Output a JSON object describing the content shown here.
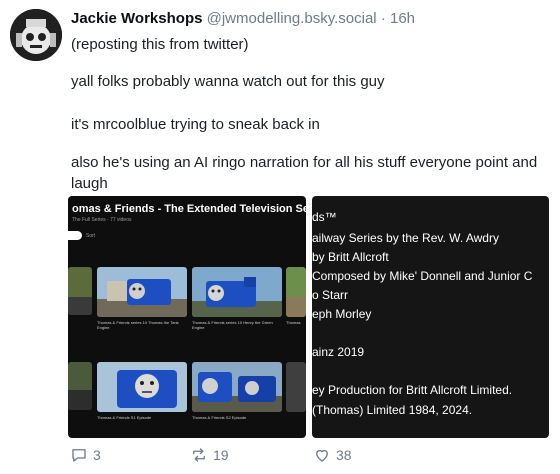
{
  "post": {
    "display_name": "Jackie Workshops",
    "handle": "@jwmodelling.bsky.social",
    "separator": "·",
    "time": "16h",
    "lines": [
      "(reposting this from twitter)",
      "yall folks probably wanna watch out for this guy",
      "it's mrcoolblue trying to sneak back in",
      "also he's using an AI ringo narration for all his stuff everyone point and laugh"
    ]
  },
  "embed_left": {
    "playlist_title": "omas & Friends - The Extended Television Series",
    "playlist_sub": "The Full Series · 77 videos",
    "sort_label": "Sort",
    "thumbs": [
      {
        "caption": "Thomas & Friends series 10 Thomas the Tank Engine",
        "label": "Thomas"
      },
      {
        "caption": "Thomas & Friends series 10 Henry the Green Engine",
        "label": "Henry"
      },
      {
        "caption": "Thomas",
        "label": "Thomas"
      },
      {
        "caption": "Thomas & Friends S1 Episode",
        "label": "Edward"
      },
      {
        "caption": "Thomas & Friends S2 Episode",
        "label": "Gordon"
      }
    ],
    "theme_colors": {
      "engine": "#1d4fc3",
      "sky": "#8bb6e0",
      "ground": "#6b7a4a"
    }
  },
  "embed_right": {
    "credit_lines": [
      "ds™",
      "ailway Series by the Rev. W. Awdry",
      "by Britt Allcroft",
      "Composed by Mike' Donnell and Junior C",
      "o Starr",
      "eph Morley",
      "ainz 2019",
      "ey Production for Britt Allcroft Limited.",
      "(Thomas) Limited 1984, 2024."
    ]
  },
  "actions": {
    "reply_count": "3",
    "repost_count": "19",
    "like_count": "38"
  },
  "icons": {
    "reply": "speech-bubble-icon",
    "repost": "repost-arrows-icon",
    "like": "heart-icon"
  }
}
